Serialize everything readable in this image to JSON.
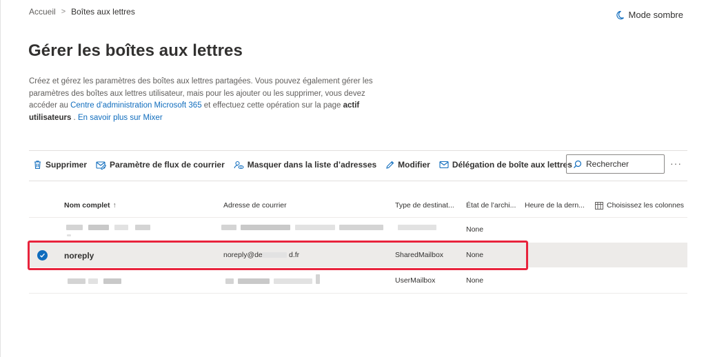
{
  "breadcrumb": {
    "home": "Accueil",
    "separator": ">",
    "current": "Boîtes aux lettres"
  },
  "dark_mode": {
    "label": "Mode sombre",
    "icon": "moon-icon"
  },
  "page": {
    "title": "Gérer les boîtes aux lettres",
    "description": {
      "part1": "Créez et gérez les paramètres des boîtes aux lettres partagées. Vous pouvez également gérer les paramètres des boîtes aux lettres utilisateur, mais pour les ajouter ou les supprimer, vous devez accéder au ",
      "link1": "Centre d’administration Microsoft 365",
      "part2": " et effectuez cette opération sur la page ",
      "bold": "actif utilisateurs",
      "part3": " . ",
      "link2": "En savoir plus sur Mixer"
    }
  },
  "toolbar": {
    "delete": "Supprimer",
    "mail_flow": "Paramètre de flux de courrier",
    "hide": "Masquer dans la liste d’adresses",
    "edit": "Modifier",
    "delegation": "Délégation de boîte aux lettres",
    "search": "Rechercher",
    "more": "···"
  },
  "table": {
    "headers": {
      "name": "Nom complet",
      "sort_arrow": "↑",
      "email": "Adresse de courrier",
      "type": "Type de destinat...",
      "archive": "État de l’archi...",
      "time": "Heure de la dern...",
      "columns": "Choisissez les colonnes"
    },
    "rows": [
      {
        "name": "",
        "email": "",
        "type": "",
        "archive": "None",
        "selected": false
      },
      {
        "name": "noreply",
        "email": "noreply@de",
        "email_suffix": "d.fr",
        "type": "SharedMailbox",
        "archive": "None",
        "selected": true
      },
      {
        "name": "",
        "email": "",
        "type": "UserMailbox",
        "archive": "None",
        "selected": false
      }
    ]
  },
  "colors": {
    "accent": "#0f6cbd",
    "highlight": "#e8233c",
    "selected_row": "#edebe9"
  }
}
